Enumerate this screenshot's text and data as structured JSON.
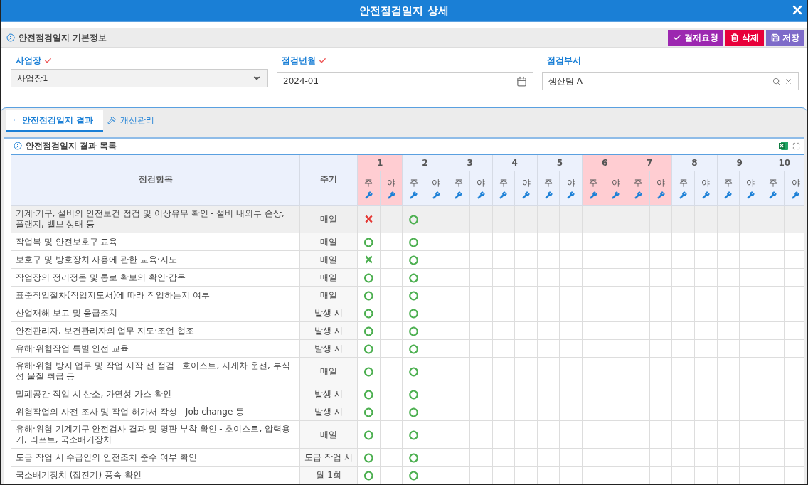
{
  "window": {
    "title": "안전점검일지 상세"
  },
  "basic_info": {
    "title": "안전점검일지 기본정보",
    "buttons": [
      {
        "kind": "approve",
        "label": "결재요청"
      },
      {
        "kind": "delete",
        "label": "삭제"
      },
      {
        "kind": "save",
        "label": "저장"
      }
    ],
    "fields": [
      {
        "kind": "select",
        "label": "사업장",
        "required": true,
        "value": "사업장1"
      },
      {
        "kind": "date",
        "label": "점검년월",
        "required": true,
        "value": "2024-01"
      },
      {
        "kind": "lookup",
        "label": "점검부서",
        "required": false,
        "value": "생산팀 A"
      }
    ]
  },
  "tabs": [
    {
      "label": "안전점검일지 결과",
      "kind": "result",
      "selected": true
    },
    {
      "label": "개선관리",
      "kind": "improve",
      "selected": false
    }
  ],
  "results": {
    "title": "안전점검일지 결과 목록",
    "columns": {
      "item": "점검항목",
      "cycle": "주기"
    },
    "days": [
      {
        "label": "1",
        "holiday": true,
        "shifts": [
          "주",
          "야"
        ]
      },
      {
        "label": "2",
        "holiday": false,
        "shifts": [
          "주",
          "야"
        ]
      },
      {
        "label": "3",
        "holiday": false,
        "shifts": [
          "주",
          "야"
        ]
      },
      {
        "label": "4",
        "holiday": false,
        "shifts": [
          "주",
          "야"
        ]
      },
      {
        "label": "5",
        "holiday": false,
        "shifts": [
          "주",
          "야"
        ]
      },
      {
        "label": "6",
        "holiday": true,
        "shifts": [
          "주",
          "야"
        ]
      },
      {
        "label": "7",
        "holiday": true,
        "shifts": [
          "주",
          "야"
        ]
      },
      {
        "label": "8",
        "holiday": false,
        "shifts": [
          "주",
          "야"
        ]
      },
      {
        "label": "9",
        "holiday": false,
        "shifts": [
          "주",
          "야"
        ]
      },
      {
        "label": "10",
        "holiday": false,
        "shifts": [
          "주",
          "야"
        ]
      }
    ],
    "rows": [
      {
        "item": "기계·기구, 설비의 안전보건 점검 및 이상유무 확인 - 설비 내외부 손상, 플랜지, 밸브 상태 등",
        "cycle": "매일",
        "selected": true,
        "marks": [
          {
            "day_shift": {
              "text": "×",
              "color": "#e53935"
            }
          },
          {
            "day_shift": {
              "text": "○",
              "color": "#4caf50"
            }
          }
        ]
      },
      {
        "item": "작업복 및 안전보호구 교육",
        "cycle": "매일",
        "selected": false,
        "marks": [
          {
            "day_shift": {
              "text": "○",
              "color": "#4caf50"
            }
          },
          {
            "day_shift": {
              "text": "○",
              "color": "#4caf50"
            }
          }
        ]
      },
      {
        "item": "보호구 및 방호장치 사용에 관한 교육·지도",
        "cycle": "매일",
        "selected": false,
        "marks": [
          {
            "day_shift": {
              "text": "×",
              "color": "#4caf50"
            }
          },
          {
            "day_shift": {
              "text": "○",
              "color": "#4caf50"
            }
          }
        ]
      },
      {
        "item": "작업장의 정리정돈 및 통로 확보의 확인·감독",
        "cycle": "매일",
        "selected": false,
        "marks": [
          {
            "day_shift": {
              "text": "○",
              "color": "#4caf50"
            }
          },
          {
            "day_shift": {
              "text": "○",
              "color": "#4caf50"
            }
          }
        ]
      },
      {
        "item": "표준작업절차(작업지도서)에 따라 작업하는지 여부",
        "cycle": "매일",
        "selected": false,
        "marks": [
          {
            "day_shift": {
              "text": "○",
              "color": "#4caf50"
            }
          },
          {
            "day_shift": {
              "text": "○",
              "color": "#4caf50"
            }
          }
        ]
      },
      {
        "item": "산업재해 보고 및 응급조치",
        "cycle": "발생 시",
        "selected": false,
        "marks": [
          {
            "day_shift": {
              "text": "○",
              "color": "#4caf50"
            }
          },
          {
            "day_shift": {
              "text": "○",
              "color": "#4caf50"
            }
          }
        ]
      },
      {
        "item": "안전관리자, 보건관리자의 업무 지도·조언 협조",
        "cycle": "발생 시",
        "selected": false,
        "marks": [
          {
            "day_shift": {
              "text": "○",
              "color": "#4caf50"
            }
          },
          {
            "day_shift": {
              "text": "○",
              "color": "#4caf50"
            }
          }
        ]
      },
      {
        "item": "유해·위험작업 특별 안전 교육",
        "cycle": "발생 시",
        "selected": false,
        "marks": [
          {
            "day_shift": {
              "text": "○",
              "color": "#4caf50"
            }
          },
          {
            "day_shift": {
              "text": "○",
              "color": "#4caf50"
            }
          }
        ]
      },
      {
        "item": "유해·위험 방지 업무 및 작업 시작 전 점검 - 호이스트, 지게차 운전, 부식성 물질 취급 등",
        "cycle": "매일",
        "selected": false,
        "marks": [
          {
            "day_shift": {
              "text": "○",
              "color": "#4caf50"
            }
          },
          {
            "day_shift": {
              "text": "○",
              "color": "#4caf50"
            }
          }
        ]
      },
      {
        "item": "밀폐공간 작업 시 산소, 가연성 가스 확인",
        "cycle": "발생 시",
        "selected": false,
        "marks": [
          {
            "day_shift": {
              "text": "○",
              "color": "#4caf50"
            }
          },
          {
            "day_shift": {
              "text": "○",
              "color": "#4caf50"
            }
          }
        ]
      },
      {
        "item": "위험작업의 사전 조사 및 작업 허가서 작성 - Job change 등",
        "cycle": "발생 시",
        "selected": false,
        "marks": [
          {
            "day_shift": {
              "text": "○",
              "color": "#4caf50"
            }
          },
          {
            "day_shift": {
              "text": "○",
              "color": "#4caf50"
            }
          }
        ]
      },
      {
        "item": "유해·위험 기계기구 안전검사 결과 및 명판 부착 확인 - 호이스트, 압력용기, 리프트, 국소배기장치",
        "cycle": "매일",
        "selected": false,
        "marks": [
          {
            "day_shift": {
              "text": "○",
              "color": "#4caf50"
            }
          },
          {
            "day_shift": {
              "text": "○",
              "color": "#4caf50"
            }
          }
        ]
      },
      {
        "item": "도급 작업 시 수급인의 안전조치 준수 여부 확인",
        "cycle": "도급 작업 시",
        "selected": false,
        "marks": [
          {
            "day_shift": {
              "text": "○",
              "color": "#4caf50"
            }
          },
          {
            "day_shift": {
              "text": "○",
              "color": "#4caf50"
            }
          }
        ]
      },
      {
        "item": "국소배기장치 (집진기) 풍속 확인",
        "cycle": "월 1회",
        "selected": false,
        "marks": [
          {
            "day_shift": {
              "text": "○",
              "color": "#4caf50"
            }
          },
          {
            "day_shift": {
              "text": "○",
              "color": "#4caf50"
            }
          }
        ]
      }
    ]
  }
}
